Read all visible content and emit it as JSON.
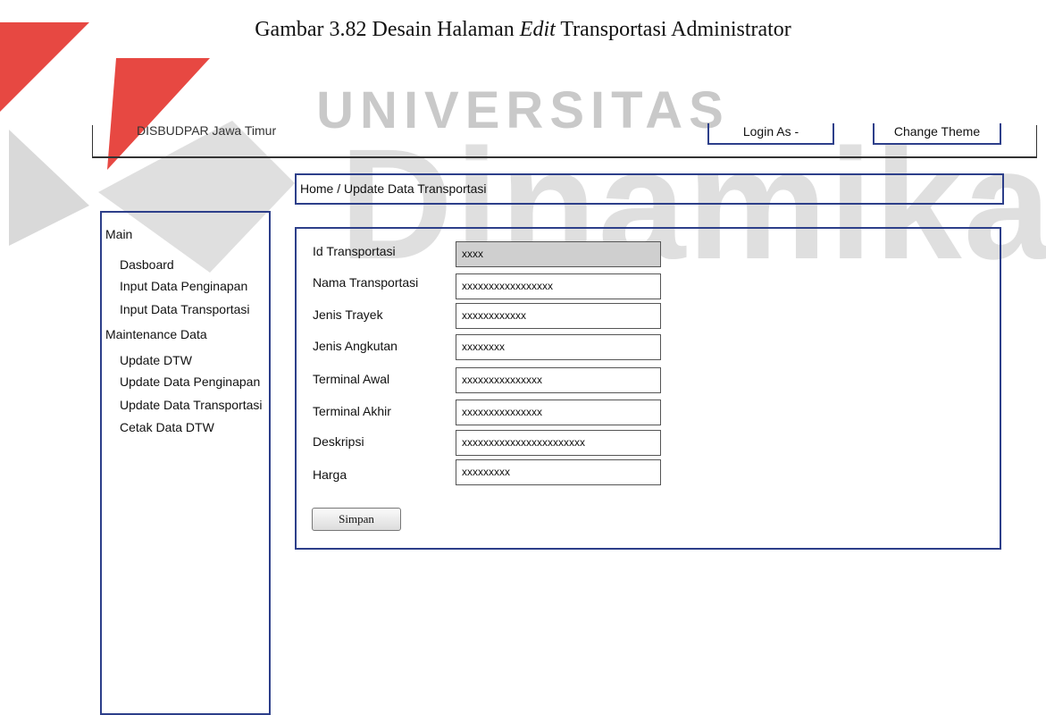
{
  "caption": {
    "prefix": "Gambar 3.82 Desain Halaman ",
    "emphasis": "Edit",
    "suffix": " Transportasi Administrator"
  },
  "watermark": {
    "top_text": "UNIVERSITAS",
    "main_text": "Dinamika",
    "logo_colors": [
      "#e4342e",
      "#c9c9c9"
    ]
  },
  "header": {
    "org_name": "DISBUDPAR Jawa Timur",
    "login_label": "Login As -",
    "theme_label": "Change Theme"
  },
  "breadcrumb": "Home / Update Data Transportasi",
  "sidebar": {
    "sections": [
      {
        "title": "Main",
        "items": [
          "Dasboard",
          "Input Data Penginapan",
          "Input Data Transportasi"
        ]
      },
      {
        "title": "Maintenance Data",
        "items": [
          "Update DTW",
          "Update Data Penginapan",
          "Update Data Transportasi",
          "Cetak Data DTW"
        ]
      }
    ]
  },
  "form": {
    "fields": [
      {
        "label": "Id Transportasi",
        "value": "xxxx",
        "readonly": true
      },
      {
        "label": "Nama Transportasi",
        "value": "xxxxxxxxxxxxxxxxx"
      },
      {
        "label": "Jenis Trayek",
        "value": "xxxxxxxxxxxx"
      },
      {
        "label": "Jenis Angkutan",
        "value": "xxxxxxxx"
      },
      {
        "label": "Terminal Awal",
        "value": "xxxxxxxxxxxxxxx"
      },
      {
        "label": "Terminal Akhir",
        "value": "xxxxxxxxxxxxxxx"
      },
      {
        "label": "Deskripsi",
        "value": "xxxxxxxxxxxxxxxxxxxxxxx"
      },
      {
        "label": "Harga",
        "value": "xxxxxxxxx"
      }
    ],
    "submit_label": "Simpan"
  },
  "colors": {
    "border": "#2d3f8a",
    "readonly_field": "#cfcfcf"
  }
}
